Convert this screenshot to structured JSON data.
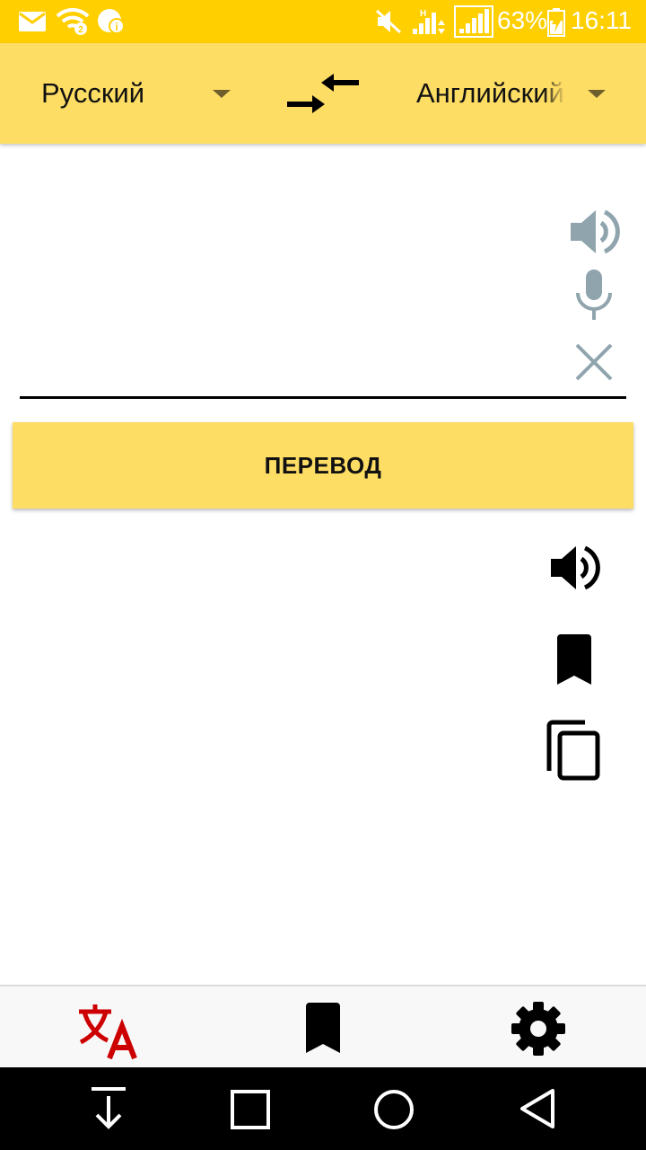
{
  "status_bar": {
    "battery": "63%",
    "time": "16:11",
    "icons": [
      "mail-icon",
      "wifi-icon",
      "notification-icon",
      "mute-icon",
      "signal-icon",
      "signal-icon",
      "battery-charging-icon"
    ]
  },
  "toolbar": {
    "source_language": "Русский",
    "target_language": "Английский",
    "swap_icon": "swap-languages-icon"
  },
  "input": {
    "value": "",
    "icons": [
      "speaker-icon",
      "microphone-icon",
      "clear-icon"
    ]
  },
  "translate_button": {
    "label": "ПЕРЕВОД"
  },
  "output": {
    "value": "",
    "icons": [
      "speaker-icon",
      "bookmark-icon",
      "copy-icon"
    ]
  },
  "bottom_nav": {
    "items": [
      "translate-icon",
      "bookmark-icon",
      "settings-icon"
    ],
    "active_color": "#cc0000"
  },
  "system_nav": {
    "items": [
      "download-icon",
      "recent-apps-icon",
      "home-icon",
      "back-icon"
    ]
  },
  "colors": {
    "status_bar": "#ffcf00",
    "toolbar": "#fedd65",
    "muted_icon": "#90a4ae"
  }
}
